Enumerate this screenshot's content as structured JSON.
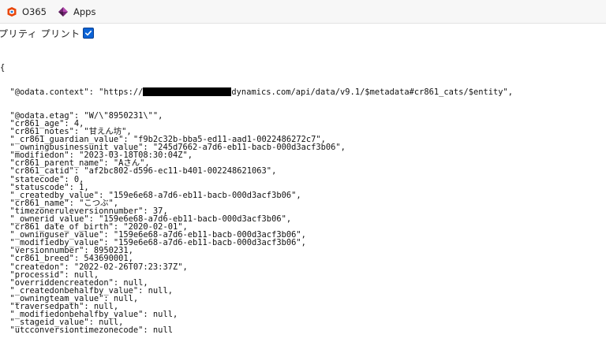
{
  "bookmarks": [
    {
      "label": "O365",
      "icon": "office-icon",
      "color": "#e8470b"
    },
    {
      "label": "Apps",
      "icon": "power-apps-icon",
      "color": "#742774"
    }
  ],
  "pretty_print": {
    "label": "プリティ プリント",
    "checked": true
  },
  "json": {
    "open_brace": "{",
    "context_prefix": "  \"@odata.context\": \"https://",
    "context_suffix": "dynamics.com/api/data/v9.1/$metadata#cr861_cats/$entity\",",
    "lines": [
      "  \"@odata.etag\": \"W/\\\"8950231\\\"\",",
      "  \"cr861_age\": 4,",
      "  \"cr861_notes\": \"甘えん坊\",",
      "  \"_cr861_guardian_value\": \"f9b2c32b-bba5-ed11-aad1-0022486272c7\",",
      "  \"_owningbusinessunit_value\": \"245d7662-a7d6-eb11-bacb-000d3acf3b06\",",
      "  \"modifiedon\": \"2023-03-18T08:30:04Z\",",
      "  \"cr861_parent_name\": \"Aさん\",",
      "  \"cr861_catid\": \"af2bc802-d596-ec11-b401-002248621063\",",
      "  \"statecode\": 0,",
      "  \"statuscode\": 1,",
      "  \"_createdby_value\": \"159e6e68-a7d6-eb11-bacb-000d3acf3b06\",",
      "  \"cr861_name\": \"こつぶ\",",
      "  \"timezoneruleversionnumber\": 37,",
      "  \"_ownerid_value\": \"159e6e68-a7d6-eb11-bacb-000d3acf3b06\",",
      "  \"cr861_date_of_birth\": \"2020-02-01\",",
      "  \"_owninguser_value\": \"159e6e68-a7d6-eb11-bacb-000d3acf3b06\",",
      "  \"_modifiedby_value\": \"159e6e68-a7d6-eb11-bacb-000d3acf3b06\",",
      "  \"versionnumber\": 8950231,",
      "  \"cr861_breed\": 543690001,",
      "  \"createdon\": \"2022-02-26T07:23:37Z\",",
      "  \"processid\": null,",
      "  \"overriddencreatedon\": null,",
      "  \"_createdonbehalfby_value\": null,",
      "  \"_owningteam_value\": null,",
      "  \"traversedpath\": null,",
      "  \"_modifiedonbehalfby_value\": null,",
      "  \"_stageid_value\": null,",
      "  \"utcconversiontimezonecode\": null"
    ]
  }
}
